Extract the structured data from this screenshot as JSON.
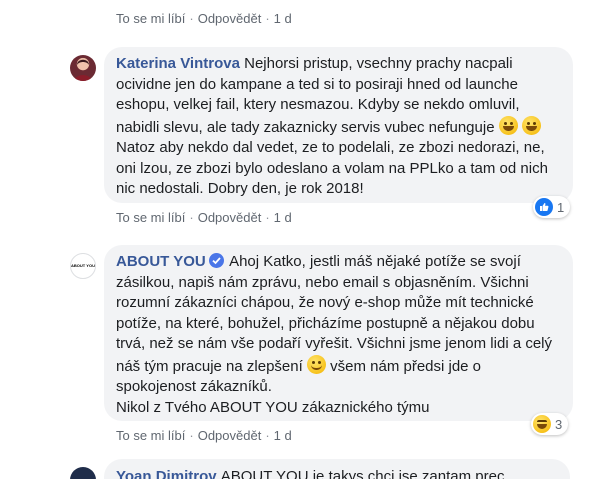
{
  "comment0": {
    "like": "To se mi líbí",
    "reply": "Odpovědět",
    "time": "1 d"
  },
  "comment1": {
    "author": "Katerina Vintrova",
    "text1": "Nejhorsi pristup, vsechny prachy nacpali ocividne jen do kampane a ted si to posiraji hned od launche eshopu, velkej fail, ktery nesmazou. Kdyby se nekdo omluvil, nabidli slevu, ale tady zakaznicky servis vubec nefunguje",
    "text2": "Natoz aby nekdo dal vedet, ze to podelali, ze zbozi nedorazi, ne, oni lzou, ze zbozi bylo odeslano a volam na PPLko a tam od nich nic nedostali. Dobry den, je rok 2018!",
    "like": "To se mi líbí",
    "reply": "Odpovědět",
    "time": "1 d",
    "reaction_count": "1"
  },
  "comment2": {
    "author": "ABOUT YOU",
    "avatar_text": "ABOUT YOU",
    "text1": "Ahoj Katko, jestli máš nějaké potíže se svojí zásilkou, napiš nám zprávu, nebo email s objasněním. Všichni rozumní zákazníci chápou, že nový e-shop může mít technické potíže, na které, bohužel, přicházíme postupně a nějakou dobu trvá, než se nám vše podaří vyřešit. Všichni jsme jenom lidi a celý náš tým pracuje na zlepšení",
    "text2": "všem nám předsi jde o spokojenost zákazníků.",
    "signature": "Nikol z Tvého ABOUT YOU zákaznického týmu",
    "like": "To se mi líbí",
    "reply": "Odpovědět",
    "time": "1 d",
    "reaction_count": "3"
  },
  "comment3": {
    "author": "Yoan Dimitrov",
    "text": "ABOUT YOU je takys chci jse zantam prec"
  },
  "colors": {
    "link": "#385898",
    "bubble": "#f2f3f5",
    "meta": "#606770",
    "like": "#1877f2"
  }
}
